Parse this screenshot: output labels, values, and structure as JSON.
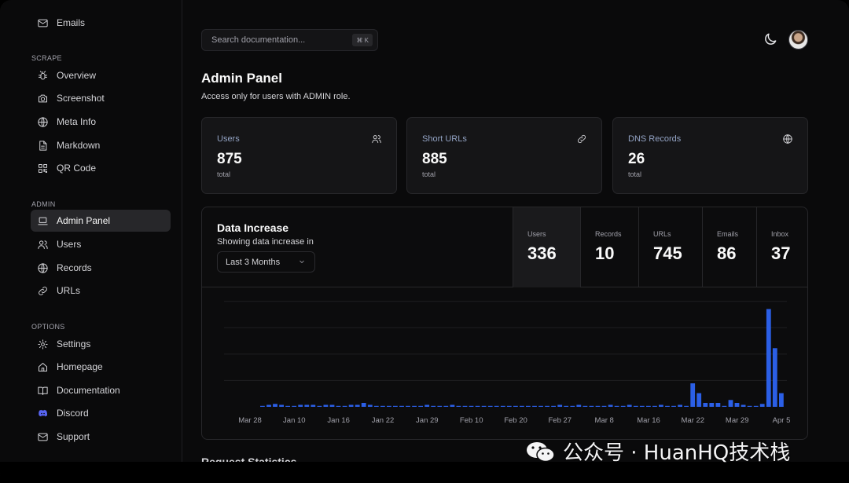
{
  "sidebar": {
    "top_item": {
      "label": "Emails",
      "icon": "mail-icon"
    },
    "sections": [
      {
        "title": "SCRAPE",
        "items": [
          {
            "label": "Overview",
            "icon": "bug-icon"
          },
          {
            "label": "Screenshot",
            "icon": "camera-icon"
          },
          {
            "label": "Meta Info",
            "icon": "globe-icon"
          },
          {
            "label": "Markdown",
            "icon": "file-icon"
          },
          {
            "label": "QR Code",
            "icon": "qr-code-icon"
          }
        ]
      },
      {
        "title": "ADMIN",
        "items": [
          {
            "label": "Admin Panel",
            "icon": "laptop-icon",
            "active": true
          },
          {
            "label": "Users",
            "icon": "users-icon"
          },
          {
            "label": "Records",
            "icon": "globe-icon"
          },
          {
            "label": "URLs",
            "icon": "link-icon"
          }
        ]
      },
      {
        "title": "OPTIONS",
        "items": [
          {
            "label": "Settings",
            "icon": "gear-icon"
          },
          {
            "label": "Homepage",
            "icon": "home-icon"
          },
          {
            "label": "Documentation",
            "icon": "book-icon"
          },
          {
            "label": "Discord",
            "icon": "discord-icon"
          },
          {
            "label": "Support",
            "icon": "mail-icon"
          }
        ]
      }
    ]
  },
  "search": {
    "placeholder": "Search documentation...",
    "shortcut": "⌘ K"
  },
  "header": {
    "title": "Admin Panel",
    "subtitle": "Access only for users with ADMIN role."
  },
  "cards": [
    {
      "label": "Users",
      "value": "875",
      "unit": "total",
      "icon": "users-icon"
    },
    {
      "label": "Short URLs",
      "value": "885",
      "unit": "total",
      "icon": "link-icon"
    },
    {
      "label": "DNS Records",
      "value": "26",
      "unit": "total",
      "icon": "globe-icon"
    }
  ],
  "panel": {
    "title": "Data Increase",
    "subtitle": "Showing data increase in",
    "range": "Last 3 Months",
    "metrics": [
      {
        "label": "Users",
        "value": "336",
        "active": true
      },
      {
        "label": "Records",
        "value": "10"
      },
      {
        "label": "URLs",
        "value": "745"
      },
      {
        "label": "Emails",
        "value": "86"
      },
      {
        "label": "Inbox",
        "value": "37"
      }
    ]
  },
  "next_section": "Request Statistics",
  "watermark": "公众号 · HuanHQ技术栈",
  "colors": {
    "accent": "#2b5fe6",
    "bg": "#0a0a0b",
    "card": "#151517"
  },
  "chart_data": {
    "type": "bar",
    "series": [
      {
        "name": "Users"
      }
    ],
    "x_ticks": [
      "Mar 28",
      "Jan 10",
      "Jan 16",
      "Jan 22",
      "Jan 29",
      "Feb 10",
      "Feb 20",
      "Feb 27",
      "Mar 8",
      "Mar 16",
      "Mar 22",
      "Mar 29",
      "Apr 5"
    ],
    "values": [
      0,
      1,
      2,
      3,
      2,
      1,
      1,
      2,
      2,
      2,
      1,
      2,
      2,
      1,
      1,
      2,
      2,
      4,
      2,
      1,
      1,
      1,
      1,
      1,
      1,
      1,
      1,
      2,
      1,
      1,
      1,
      2,
      1,
      1,
      1,
      1,
      1,
      1,
      1,
      1,
      1,
      1,
      1,
      1,
      1,
      1,
      1,
      1,
      2,
      1,
      1,
      2,
      1,
      1,
      1,
      1,
      2,
      1,
      1,
      2,
      1,
      1,
      1,
      1,
      2,
      1,
      1,
      2,
      1,
      24,
      14,
      4,
      4,
      4,
      1,
      7,
      4,
      2,
      1,
      1,
      3,
      100,
      60,
      14
    ],
    "ylim": [
      0,
      110
    ],
    "grid": true
  }
}
